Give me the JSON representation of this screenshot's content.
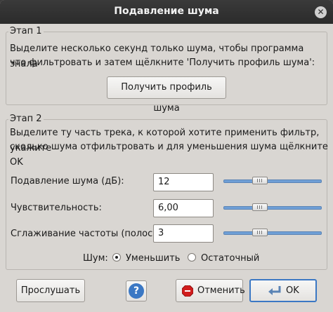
{
  "window": {
    "title": "Подавление шума"
  },
  "step1": {
    "legend": "Этап 1",
    "line1": "Выделите несколько секунд только шума, чтобы программа знала",
    "line2": "что фильтровать и затем щёлкните 'Получить профиль шума':",
    "get_profile_button": "Получить профиль шума"
  },
  "step2": {
    "legend": "Этап 2",
    "line1": "Выделите ту часть трека, к которой хотите применить фильтр, укажите",
    "line2": "сколько шума отфильтровать и для уменьшения шума щёлкните OK",
    "noise_reduction": {
      "label": "Подавление шума (дБ):",
      "value": "12",
      "slider_fraction": 0.35
    },
    "sensitivity": {
      "label": "Чувствительность:",
      "value": "6,00",
      "slider_fraction": 0.35
    },
    "smoothing": {
      "label": "Сглаживание частоты (полосы):",
      "value": "3",
      "slider_fraction": 0.35
    },
    "noise_label": "Шум:",
    "noise_option_reduce": "Уменьшить",
    "noise_option_residue": "Остаточный",
    "noise_selected": "reduce"
  },
  "buttons": {
    "preview": "Прослушать",
    "help_icon": "?",
    "cancel": "Отменить",
    "ok": "OK"
  },
  "colors": {
    "accent": "#3b78c4",
    "cancel_icon": "#d11d1d"
  }
}
